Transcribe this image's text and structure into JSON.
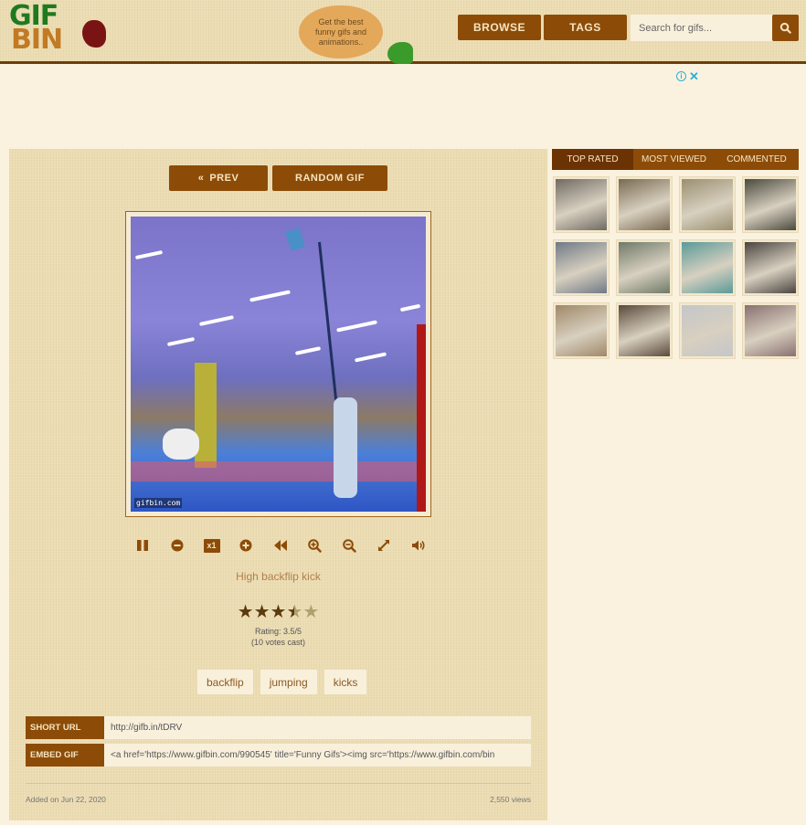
{
  "header": {
    "logo": {
      "line1": "GIF",
      "line2": "BIN"
    },
    "tagline": "Get the best funny gifs and animations..",
    "nav": {
      "browse_label": "BROWSE",
      "tags_label": "TAGS"
    },
    "search": {
      "placeholder": "Search for gifs...",
      "value": ""
    }
  },
  "ad": {
    "info_label": "i",
    "close_label": "✕"
  },
  "main": {
    "prev_label": "PREV",
    "prev_icon": "«",
    "random_label": "RANDOM GIF",
    "gif": {
      "watermark": "gifbin.com",
      "title": "High backflip kick"
    },
    "controls": [
      {
        "name": "pause-icon",
        "label": "pause"
      },
      {
        "name": "slower-icon",
        "label": "slower"
      },
      {
        "name": "speed-badge",
        "label": "x1"
      },
      {
        "name": "faster-icon",
        "label": "faster"
      },
      {
        "name": "rewind-icon",
        "label": "reverse"
      },
      {
        "name": "zoom-in-icon",
        "label": "zoom in"
      },
      {
        "name": "zoom-out-icon",
        "label": "zoom out"
      },
      {
        "name": "fullscreen-icon",
        "label": "fullscreen"
      },
      {
        "name": "volume-icon",
        "label": "sound"
      }
    ],
    "speed": "x1",
    "rating": {
      "value": 3.5,
      "max": 5,
      "text": "Rating: 3.5/5",
      "votes_text": "(10 votes cast)"
    },
    "tags": [
      "backflip",
      "jumping",
      "kicks"
    ],
    "short_url": {
      "label": "SHORT URL",
      "value": "http://gifb.in/tDRV"
    },
    "embed": {
      "label": "EMBED GIF",
      "value": "<a href='https://www.gifbin.com/990545' title='Funny Gifs'><img src='https://www.gifbin.com/bin"
    },
    "added": "Added on Jun 22, 2020",
    "views": "2,550 views"
  },
  "sidebar": {
    "tabs": [
      {
        "label": "TOP RATED",
        "active": true
      },
      {
        "label": "MOST VIEWED",
        "active": false
      },
      {
        "label": "COMMENTED",
        "active": false
      }
    ],
    "thumbnails": [
      {
        "desc": "person holding cat by garage",
        "color": "#6f6a62"
      },
      {
        "desc": "man bending in yard",
        "color": "#7a6a52"
      },
      {
        "desc": "dog near blue chair",
        "color": "#9a8f70"
      },
      {
        "desc": "men in dark coats",
        "color": "#4a4a3e"
      },
      {
        "desc": "car on street",
        "color": "#707a86"
      },
      {
        "desc": "people on road",
        "color": "#6f7a68"
      },
      {
        "desc": "people by pool",
        "color": "#5a9a98"
      },
      {
        "desc": "chimp on pillow",
        "color": "#4a4440"
      },
      {
        "desc": "kids at table",
        "color": "#a08868"
      },
      {
        "desc": "animal in dirt",
        "color": "#5a4a3c"
      },
      {
        "desc": "white truck",
        "color": "#c4c6c8"
      },
      {
        "desc": "person near graffiti wall",
        "color": "#8a7070"
      }
    ]
  }
}
